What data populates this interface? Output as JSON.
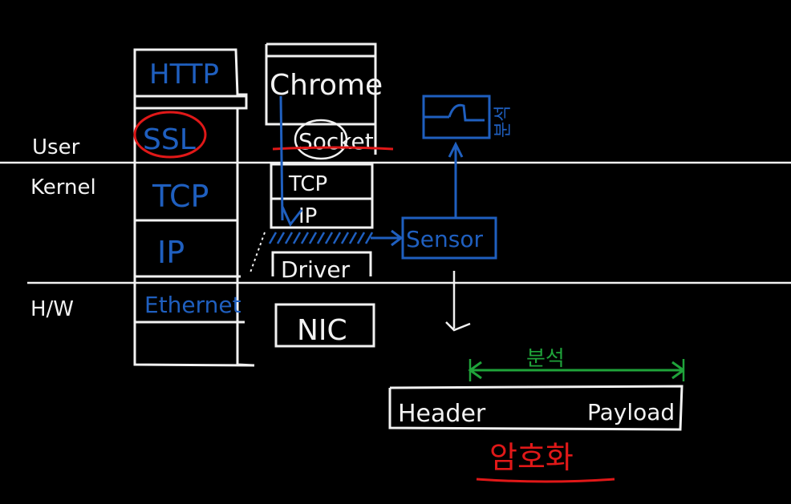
{
  "colors": {
    "background": "#000000",
    "white": "#f2f2f2",
    "blue": "#1f5fbf",
    "green": "#1fa33a",
    "red": "#e01818"
  },
  "layers": {
    "user": "User",
    "kernel": "Kernel",
    "hw": "H/W"
  },
  "osi_stack": [
    "HTTP",
    "SSL",
    "TCP",
    "IP",
    "Ethernet"
  ],
  "host_stack": {
    "app": "Chrome",
    "socket": "Socket",
    "tcp": "TCP",
    "ip": "IP",
    "driver": "Driver",
    "nic": "NIC"
  },
  "sensor": "Sensor",
  "analysis_label": "분석",
  "packet": {
    "header": "Header",
    "payload": "Payload",
    "range_label": "분석",
    "encrypted_label": "암호화"
  }
}
